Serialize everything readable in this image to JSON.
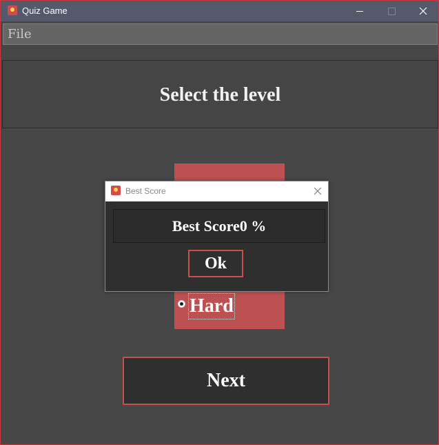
{
  "window": {
    "title": "Quiz Game",
    "icon": "app-icon"
  },
  "menu": {
    "items": [
      "File"
    ]
  },
  "header": {
    "title": "Select the level"
  },
  "level_selector": {
    "selected_label": "Hard"
  },
  "actions": {
    "next_label": "Next"
  },
  "dialog": {
    "title": "Best Score",
    "message": "Best Score0 %",
    "ok_label": "Ok"
  },
  "colors": {
    "background": "#474747",
    "titlebar": "#545a6b",
    "accent": "#c9504d",
    "level_panel": "#bd5151",
    "dark_surface": "#2f2f2f"
  }
}
